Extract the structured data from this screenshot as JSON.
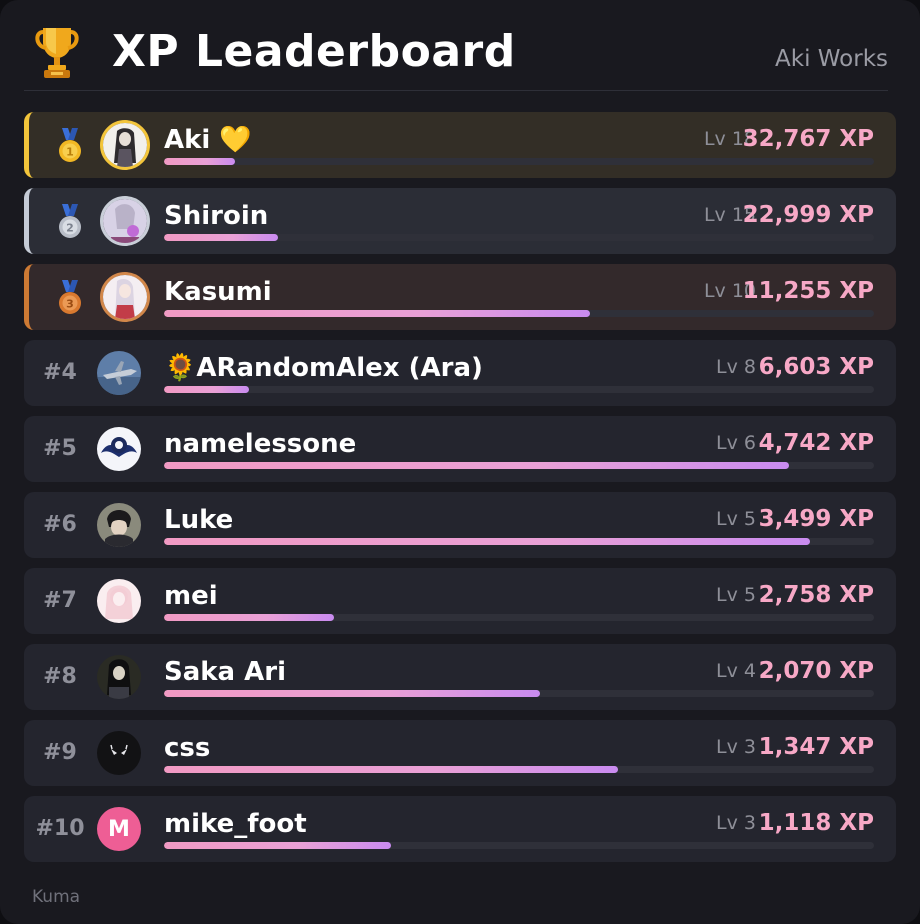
{
  "header": {
    "title": "XP Leaderboard",
    "server": "Aki Works",
    "icon": "trophy-icon"
  },
  "colors": {
    "gold": "#f3c53b",
    "silver": "#c5cbd6",
    "bronze": "#cd7a34",
    "xp_text": "#f7a8c6",
    "bar_gradient": [
      "#f19ac3",
      "#c98bf0"
    ]
  },
  "entries": [
    {
      "rank": "1",
      "medal": "gold-medal-icon",
      "name": "Aki 💛",
      "level": "Lv 18",
      "xp": "32,767 XP",
      "progress": 0.1
    },
    {
      "rank": "2",
      "medal": "silver-medal-icon",
      "name": "Shiroin",
      "level": "Lv 15",
      "xp": "22,999 XP",
      "progress": 0.16
    },
    {
      "rank": "3",
      "medal": "bronze-medal-icon",
      "name": "Kasumi",
      "level": "Lv 10",
      "xp": "11,255 XP",
      "progress": 0.6
    },
    {
      "rank": "#4",
      "name": "🌻ARandomAlex (Ara)",
      "level": "Lv 8",
      "xp": "6,603 XP",
      "progress": 0.12
    },
    {
      "rank": "#5",
      "name": "namelessone",
      "level": "Lv 6",
      "xp": "4,742 XP",
      "progress": 0.88
    },
    {
      "rank": "#6",
      "name": "Luke",
      "level": "Lv 5",
      "xp": "3,499 XP",
      "progress": 0.91
    },
    {
      "rank": "#7",
      "name": "mei",
      "level": "Lv 5",
      "xp": "2,758 XP",
      "progress": 0.24
    },
    {
      "rank": "#8",
      "name": "Saka Ari",
      "level": "Lv 4",
      "xp": "2,070 XP",
      "progress": 0.53
    },
    {
      "rank": "#9",
      "name": "css",
      "level": "Lv 3",
      "xp": "1,347 XP",
      "progress": 0.64
    },
    {
      "rank": "#10",
      "name": "mike_foot",
      "level": "Lv 3",
      "xp": "1,118 XP",
      "progress": 0.32,
      "avatar_letter": "M"
    }
  ],
  "footer": "Kuma"
}
